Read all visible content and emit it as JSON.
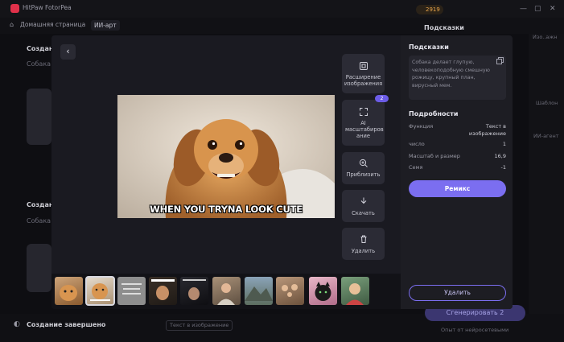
{
  "app": {
    "title": "HitPaw FotorPea",
    "credits": "2919"
  },
  "nav": {
    "home": "Домашняя страница",
    "ai_tab": "ИИ-арт"
  },
  "background": {
    "section1_title": "Создан",
    "section1_sub": "Собака",
    "section2_title": "Создан",
    "section2_sub": "Собака",
    "bottom_title": "Создание завершено",
    "bottom_badge": "Текст в изображение",
    "generate_label": "Сгенерировать",
    "generate_count": "2",
    "hint": "Опыт от нейросетевыми",
    "hints_header": "Подсказки",
    "right_items": [
      "Изо..ажн",
      "Шаблон",
      "ИИ-агент"
    ]
  },
  "viewer": {
    "meme_caption": "WHEN YOU TRYNA LOOK CUTE",
    "tools": [
      {
        "label": "Расширение изображения",
        "icon": "expand-icon"
      },
      {
        "label": "AI масштабиров ание",
        "icon": "upscale-icon",
        "badge": "2"
      },
      {
        "label": "Приблизить",
        "icon": "zoom-in-icon"
      },
      {
        "label": "Скачать",
        "icon": "download-icon"
      },
      {
        "label": "Удалить",
        "icon": "trash-icon"
      }
    ],
    "thumbnails": [
      "dog-1",
      "dog-2",
      "text-card",
      "meme-cute",
      "meme-dark",
      "woman-portrait",
      "mountain",
      "family",
      "black-cat",
      "boy-portrait"
    ]
  },
  "sidebar": {
    "prompt_header": "Подсказки",
    "prompt_text": "Собака делает глупую, человекоподобную смешную рожицу, крупный план, вирусный мем.",
    "details_header": "Подробности",
    "details": [
      {
        "label": "Функция",
        "value": "Текст в изображение"
      },
      {
        "label": "число",
        "value": "1"
      },
      {
        "label": "Масштаб и размер",
        "value": "16,9"
      },
      {
        "label": "Семя",
        "value": "-1"
      }
    ],
    "remix_label": "Ремикс",
    "delete_label": "Удалить"
  },
  "colors": {
    "accent": "#7b6ef0",
    "brand": "#e0314a"
  }
}
